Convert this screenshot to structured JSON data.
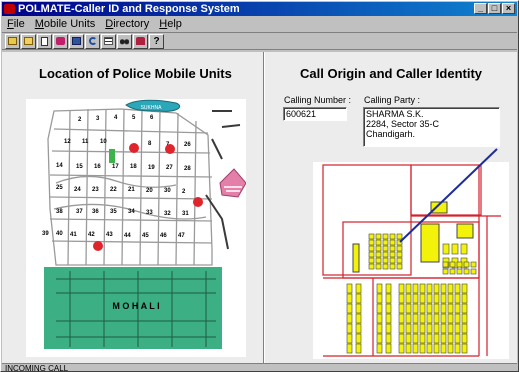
{
  "window": {
    "title": "POLMATE-Caller ID and Response System",
    "controls": {
      "minimize": "_",
      "maximize": "□",
      "close": "×"
    }
  },
  "menu": [
    "File",
    "Mobile Units",
    "Directory",
    "Help"
  ],
  "toolbar": {
    "icons": [
      "open-folder-icon",
      "open-icon",
      "new-document-icon",
      "record-icon",
      "save-icon",
      "undo-icon",
      "list-icon",
      "binoculars-icon",
      "phone-icon",
      "help-icon"
    ],
    "help_glyph": "?"
  },
  "left_panel": {
    "title": "Location of Police Mobile Units",
    "map": {
      "sector_labels": [
        "2",
        "3",
        "4",
        "5",
        "6",
        "12",
        "11",
        "10",
        "8",
        "7",
        "26",
        "14",
        "15",
        "16",
        "17",
        "18",
        "19",
        "27",
        "28",
        "25",
        "24",
        "23",
        "22",
        "21",
        "20",
        "30",
        "2",
        "38",
        "37",
        "36",
        "35",
        "34",
        "33",
        "32",
        "31",
        "39",
        "40",
        "41",
        "42",
        "43",
        "44",
        "45",
        "46",
        "47"
      ],
      "place_labels": {
        "lake": "SUKHNA",
        "town": "M O H A L I"
      },
      "unit_markers": 4,
      "colors": {
        "town": "#3caf84",
        "lake": "#2aa7b8",
        "marker": "#e0242c",
        "park": "#3cb44b",
        "hills": "#e37fa9"
      }
    }
  },
  "right_panel": {
    "title": "Call Origin and Caller Identity",
    "calling_number": {
      "label": "Calling Number :",
      "value": "600621"
    },
    "calling_party": {
      "label": "Calling Party :",
      "lines": [
        "SHARMA S.K.",
        "2284, Sector 35-C",
        "Chandigarh."
      ]
    },
    "plan_colors": {
      "plot": "#f2f20a",
      "boundary": "#d3202a",
      "pointer": "#1d2d9e"
    }
  },
  "status": {
    "text": "INCOMING CALL"
  }
}
